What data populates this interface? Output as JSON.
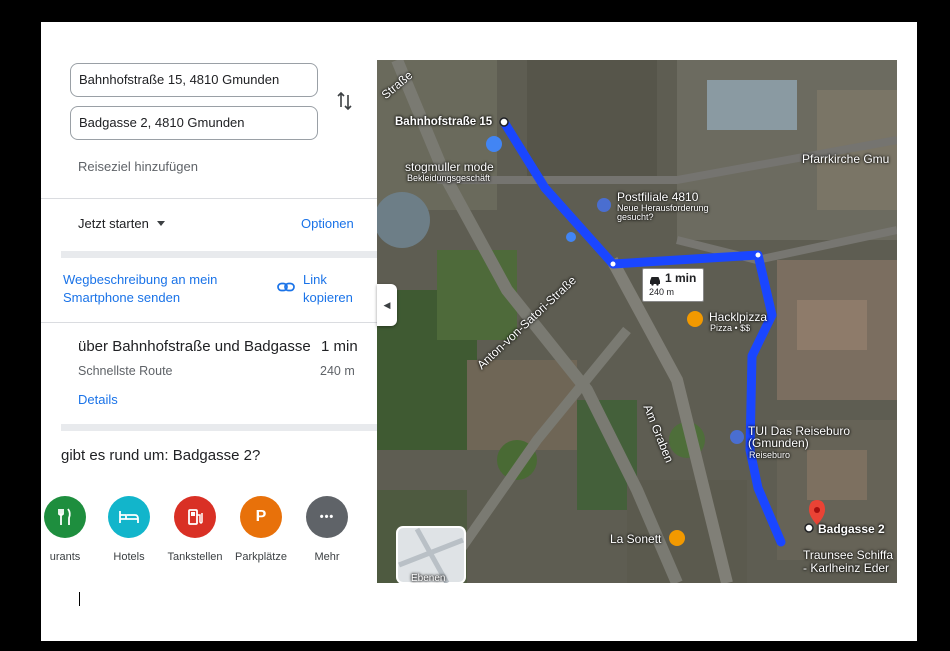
{
  "directions": {
    "origin_value": "Bahnhofstraße 15, 4810 Gmunden",
    "destination_value": "Badgasse 2, 4810 Gmunden",
    "add_destination": "Reiseziel hinzufügen",
    "swap_icon": "swap-vert-icon",
    "depart_label": "Jetzt starten",
    "options_label": "Optionen",
    "send_to_phone_line1": "Wegbeschreibung an mein",
    "send_to_phone_line2": "Smartphone senden",
    "copy_link_line1": "Link",
    "copy_link_line2": "kopieren",
    "link_icon": "link-icon"
  },
  "route": {
    "title": "über Bahnhofstraße und Badgasse",
    "duration": "1 min",
    "subtitle": "Schnellste Route",
    "distance": "240 m",
    "details_label": "Details"
  },
  "nearby": {
    "heading": "gibt es rund um: Badgasse 2?",
    "categories": [
      {
        "label": "urants",
        "icon": "restaurant-icon",
        "color": "#1e8e3e"
      },
      {
        "label": "Hotels",
        "icon": "hotel-icon",
        "color": "#12b5cb"
      },
      {
        "label": "Tankstellen",
        "icon": "gas-station-icon",
        "color": "#d93025"
      },
      {
        "label": "Parkplätze",
        "icon": "parking-icon",
        "color": "#e8710a"
      },
      {
        "label": "Mehr",
        "icon": "more-icon",
        "color": "#5f6368"
      }
    ],
    "parking_glyph": "P",
    "more_glyph": "•••"
  },
  "map": {
    "route_color": "#1a46ff",
    "street_top_left": "Straße",
    "origin_label": "Bahnhofstraße 15",
    "place_stogmuller": "stogmuller mode",
    "place_stogmuller_sub": "Bekleidungsgeschäft",
    "place_post": "Postfiliale 4810",
    "place_post_sub1": "Neue Herausforderung",
    "place_post_sub2": "gesucht?",
    "place_church": "Pfarrkirche Gmu",
    "duration": "1 min",
    "distance": "240 m",
    "place_pizza": "Hacklpizza",
    "place_pizza_sub": "Pizza • $$",
    "street_satori": "Anton-von-Satori-Straße",
    "street_graben": "Am Graben",
    "place_tui_1": "TUI Das Reiseburo",
    "place_tui_2": "(Gmunden)",
    "place_tui_sub": "Reiseburo",
    "place_sonett": "La Sonett",
    "destination_label": "Badgasse 2",
    "place_traunsee_1": "Traunsee Schiffa",
    "place_traunsee_2": "- Karlheinz Eder",
    "layers_label": "Ebenen",
    "collapse_glyph": "◀"
  }
}
